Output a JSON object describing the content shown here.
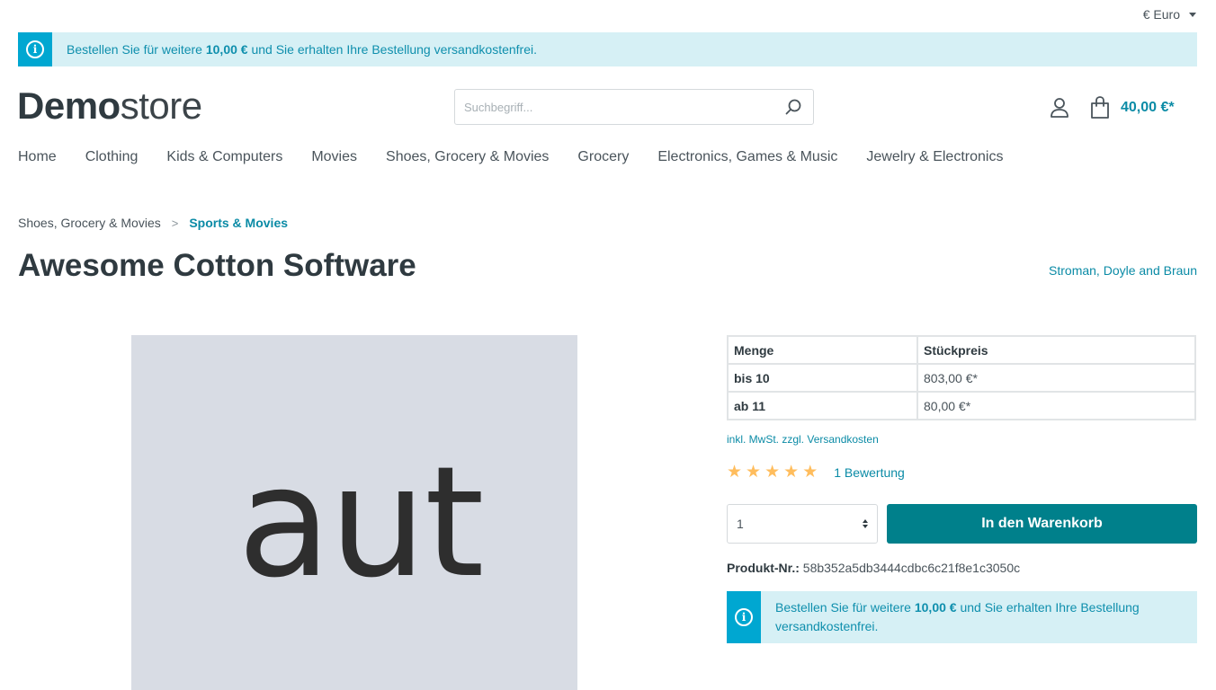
{
  "currency": {
    "label": "€ Euro"
  },
  "shipping_alert": {
    "prefix": "Bestellen Sie für weitere ",
    "amount": "10,00 €",
    "suffix": " und Sie erhalten Ihre Bestellung versandkostenfrei."
  },
  "logo": {
    "bold": "Demo",
    "light": "store"
  },
  "search": {
    "placeholder": "Suchbegriff..."
  },
  "header": {
    "cart_total": "40,00 €*"
  },
  "nav": {
    "items": [
      {
        "label": "Home"
      },
      {
        "label": "Clothing"
      },
      {
        "label": "Kids & Computers"
      },
      {
        "label": "Movies"
      },
      {
        "label": "Shoes, Grocery & Movies"
      },
      {
        "label": "Grocery"
      },
      {
        "label": "Electronics, Games & Music"
      },
      {
        "label": "Jewelry & Electronics"
      }
    ]
  },
  "breadcrumb": {
    "parent": "Shoes, Grocery & Movies",
    "separator": ">",
    "current": "Sports & Movies"
  },
  "product": {
    "title": "Awesome Cotton Software",
    "manufacturer": "Stroman, Doyle and Braun",
    "image_text": "aut",
    "price_table": {
      "headers": [
        "Menge",
        "Stückpreis"
      ],
      "rows": [
        {
          "qty": "bis 10",
          "price": "803,00 €*"
        },
        {
          "qty": "ab 11",
          "price": "80,00 €*"
        }
      ]
    },
    "tax_note": "inkl. MwSt. zzgl. Versandkosten",
    "rating": {
      "stars": 5,
      "label": "1 Bewertung"
    },
    "quantity": "1",
    "buy_label": "In den Warenkorb",
    "number_label": "Produkt-Nr.:",
    "number_value": "58b352a5db3444cdbc6c21f8e1c3050c"
  },
  "colors": {
    "accent": "#0b8ba6",
    "info": "#00a7d1",
    "info_bg": "#d6f0f5",
    "buy_button": "#00808b",
    "star": "#ffbd5d"
  }
}
